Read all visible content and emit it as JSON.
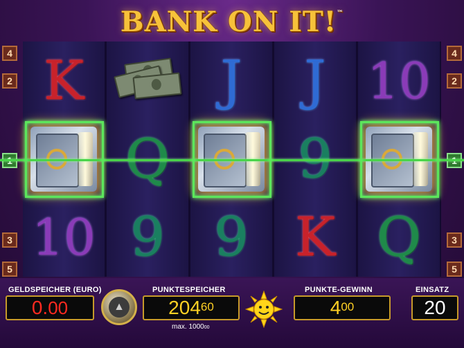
{
  "title": {
    "text": "BANK ON IT!",
    "tm": "™"
  },
  "lines": {
    "left": [
      "4",
      "2",
      "1",
      "3",
      "5"
    ],
    "right": [
      "4",
      "2",
      "1",
      "3",
      "5"
    ],
    "active": "1"
  },
  "reels": [
    {
      "top": "K",
      "middle": "safe",
      "bottom": "10"
    },
    {
      "top": "money",
      "middle": "Q",
      "bottom": "9"
    },
    {
      "top": "J",
      "middle": "safe",
      "bottom": "9"
    },
    {
      "top": "J",
      "middle": "9",
      "bottom": "K"
    },
    {
      "top": "10",
      "middle": "safe",
      "bottom": "Q"
    }
  ],
  "panel": {
    "geldspeicher_label": "GELDSPEICHER (EURO)",
    "geldspeicher_main": "0.",
    "geldspeicher_cents": "00",
    "punktespeicher_label": "PUNKTESPEICHER",
    "punktespeicher_main": "204",
    "punktespeicher_small": "60",
    "max_label": "max. 1000",
    "max_small": "00",
    "gewinn_label": "PUNKTE-GEWINN",
    "gewinn_main": "4",
    "gewinn_small": "00",
    "einsatz_label": "EINSATZ",
    "einsatz_value": "20"
  },
  "icons": {
    "autoplay": "autoplay-button-icon",
    "sun": "sun-logo-icon",
    "safe": "safe-icon",
    "money": "money-icon"
  },
  "colors": {
    "accent_gold": "#f7c23a",
    "win_green": "#5ce65c",
    "credit_red": "#ff2a20",
    "points_yellow": "#ffd024"
  }
}
